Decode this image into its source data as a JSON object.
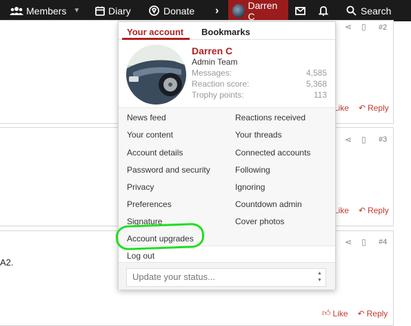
{
  "nav": {
    "members": "Members",
    "diary": "Diary",
    "donate": "Donate",
    "user": "Darren C",
    "search": "Search"
  },
  "posts": [
    {
      "num": "#2",
      "like": "Like",
      "reply": "Reply"
    },
    {
      "num": "#3",
      "like": "Like",
      "reply": "Reply"
    },
    {
      "num": "#4",
      "like": "Like",
      "reply": "Reply",
      "text": "A2."
    }
  ],
  "menu": {
    "tabs": [
      "Your account",
      "Bookmarks"
    ],
    "profile": {
      "name": "Darren C",
      "title": "Admin Team",
      "stats": [
        {
          "label": "Messages:",
          "value": "4,585"
        },
        {
          "label": "Reaction score:",
          "value": "5,368"
        },
        {
          "label": "Trophy points:",
          "value": "113"
        }
      ]
    },
    "links_left": [
      "News feed",
      "Your content",
      "Account details",
      "Password and security",
      "Privacy",
      "Preferences",
      "Signature",
      "Account upgrades"
    ],
    "links_right": [
      "Reactions received",
      "Your threads",
      "Connected accounts",
      "Following",
      "Ignoring",
      "Countdown admin",
      "Cover photos"
    ],
    "logout": "Log out",
    "status_placeholder": "Update your status..."
  },
  "colors": {
    "accent": "#b02020",
    "nav_bg": "#1b1b1b",
    "highlight": "#22dd22"
  }
}
